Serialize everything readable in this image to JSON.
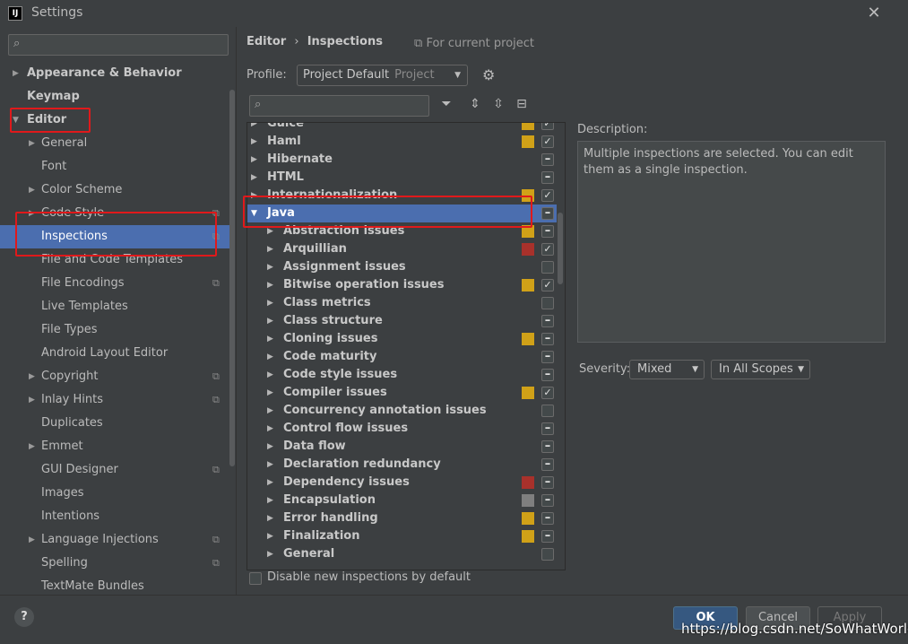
{
  "window": {
    "title": "Settings",
    "app_icon_text": "IJ"
  },
  "sidebar": {
    "search_placeholder": "",
    "items": [
      {
        "label": "Appearance & Behavior",
        "arrow": "right"
      },
      {
        "label": "Keymap",
        "arrow": ""
      },
      {
        "label": "Editor",
        "arrow": "down"
      },
      {
        "label": "General",
        "arrow": "right"
      },
      {
        "label": "Font",
        "arrow": ""
      },
      {
        "label": "Color Scheme",
        "arrow": "right"
      },
      {
        "label": "Code Style",
        "arrow": "right"
      },
      {
        "label": "Inspections",
        "arrow": ""
      },
      {
        "label": "File and Code Templates",
        "arrow": ""
      },
      {
        "label": "File Encodings",
        "arrow": ""
      },
      {
        "label": "Live Templates",
        "arrow": ""
      },
      {
        "label": "File Types",
        "arrow": ""
      },
      {
        "label": "Android Layout Editor",
        "arrow": ""
      },
      {
        "label": "Copyright",
        "arrow": "right"
      },
      {
        "label": "Inlay Hints",
        "arrow": "right"
      },
      {
        "label": "Duplicates",
        "arrow": ""
      },
      {
        "label": "Emmet",
        "arrow": "right"
      },
      {
        "label": "GUI Designer",
        "arrow": ""
      },
      {
        "label": "Images",
        "arrow": ""
      },
      {
        "label": "Intentions",
        "arrow": ""
      },
      {
        "label": "Language Injections",
        "arrow": "right"
      },
      {
        "label": "Spelling",
        "arrow": ""
      },
      {
        "label": "TextMate Bundles",
        "arrow": ""
      }
    ]
  },
  "header": {
    "breadcrumb_parent": "Editor",
    "breadcrumb_sep": "›",
    "breadcrumb_current": "Inspections",
    "for_project": "For current project"
  },
  "profile": {
    "label": "Profile:",
    "value": "Project Default",
    "scope": "Project"
  },
  "inspections": {
    "search_placeholder": "",
    "rows": [
      {
        "label": "Guice",
        "sev": "#d0a118",
        "check": "checked"
      },
      {
        "label": "Haml",
        "sev": "#d0a118",
        "check": "checked"
      },
      {
        "label": "Hibernate",
        "sev": "",
        "check": "mixed"
      },
      {
        "label": "HTML",
        "sev": "",
        "check": "mixed"
      },
      {
        "label": "Internationalization",
        "sev": "#d0a118",
        "check": "checked"
      },
      {
        "label": "Java",
        "sev": "",
        "check": "mixed"
      },
      {
        "label": "Abstraction issues",
        "sev": "#d0a118",
        "check": "mixed"
      },
      {
        "label": "Arquillian",
        "sev": "#a8312b",
        "check": "checked"
      },
      {
        "label": "Assignment issues",
        "sev": "",
        "check": "unchecked"
      },
      {
        "label": "Bitwise operation issues",
        "sev": "#d0a118",
        "check": "checked"
      },
      {
        "label": "Class metrics",
        "sev": "",
        "check": "unchecked"
      },
      {
        "label": "Class structure",
        "sev": "",
        "check": "mixed"
      },
      {
        "label": "Cloning issues",
        "sev": "#d0a118",
        "check": "mixed"
      },
      {
        "label": "Code maturity",
        "sev": "",
        "check": "mixed"
      },
      {
        "label": "Code style issues",
        "sev": "",
        "check": "mixed"
      },
      {
        "label": "Compiler issues",
        "sev": "#d0a118",
        "check": "checked"
      },
      {
        "label": "Concurrency annotation issues",
        "sev": "",
        "check": "unchecked"
      },
      {
        "label": "Control flow issues",
        "sev": "",
        "check": "mixed"
      },
      {
        "label": "Data flow",
        "sev": "",
        "check": "mixed"
      },
      {
        "label": "Declaration redundancy",
        "sev": "",
        "check": "mixed"
      },
      {
        "label": "Dependency issues",
        "sev": "#a8312b",
        "check": "mixed"
      },
      {
        "label": "Encapsulation",
        "sev": "#7f7f7f",
        "check": "mixed"
      },
      {
        "label": "Error handling",
        "sev": "#d0a118",
        "check": "mixed"
      },
      {
        "label": "Finalization",
        "sev": "#d0a118",
        "check": "mixed"
      },
      {
        "label": "General",
        "sev": "",
        "check": "unchecked"
      }
    ]
  },
  "description": {
    "label": "Description:",
    "text": "Multiple inspections are selected. You can edit them as a single inspection."
  },
  "severity": {
    "label": "Severity:",
    "value": "Mixed",
    "scope": "In All Scopes"
  },
  "disable_new": {
    "label": "Disable new inspections by default"
  },
  "buttons": {
    "help": "?",
    "ok": "OK",
    "cancel": "Cancel",
    "apply": "Apply"
  },
  "watermark": "https://blog.csdn.net/SoWhatWorld"
}
